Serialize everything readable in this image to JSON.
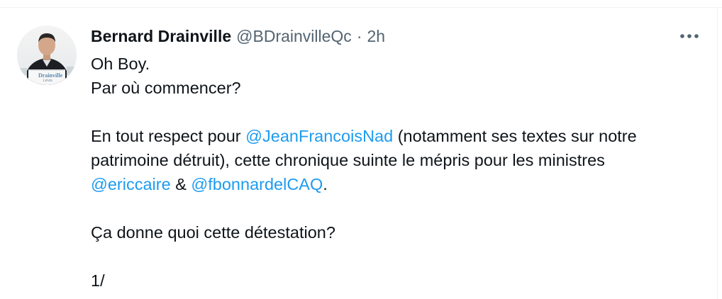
{
  "tweet": {
    "author": {
      "display_name": "Bernard Drainville",
      "handle": "@BDrainvilleQc",
      "separator": "·",
      "time": "2h"
    },
    "avatar": {
      "icon": "user-avatar-photo",
      "banner_text": "Drainville",
      "banner_subtext": "Lévis"
    },
    "more_icon": "more-options-icon",
    "text": {
      "line1": "Oh Boy.",
      "line2": "Par où commencer?",
      "line3_a": "En tout respect pour ",
      "mention1": "@JeanFrancoisNad",
      "line3_b": " (notamment ses textes sur notre",
      "line4": "patrimoine détruit), cette chronique suinte le mépris pour les ministres",
      "mention2": "@ericcaire",
      "line5_mid": " & ",
      "mention3": "@fbonnardelCAQ",
      "line5_end": ".",
      "line6": "Ça donne quoi cette détestation?",
      "line7": "1/"
    },
    "colors": {
      "text": "#0f1419",
      "secondary": "#536471",
      "link": "#1d9bf0"
    }
  }
}
